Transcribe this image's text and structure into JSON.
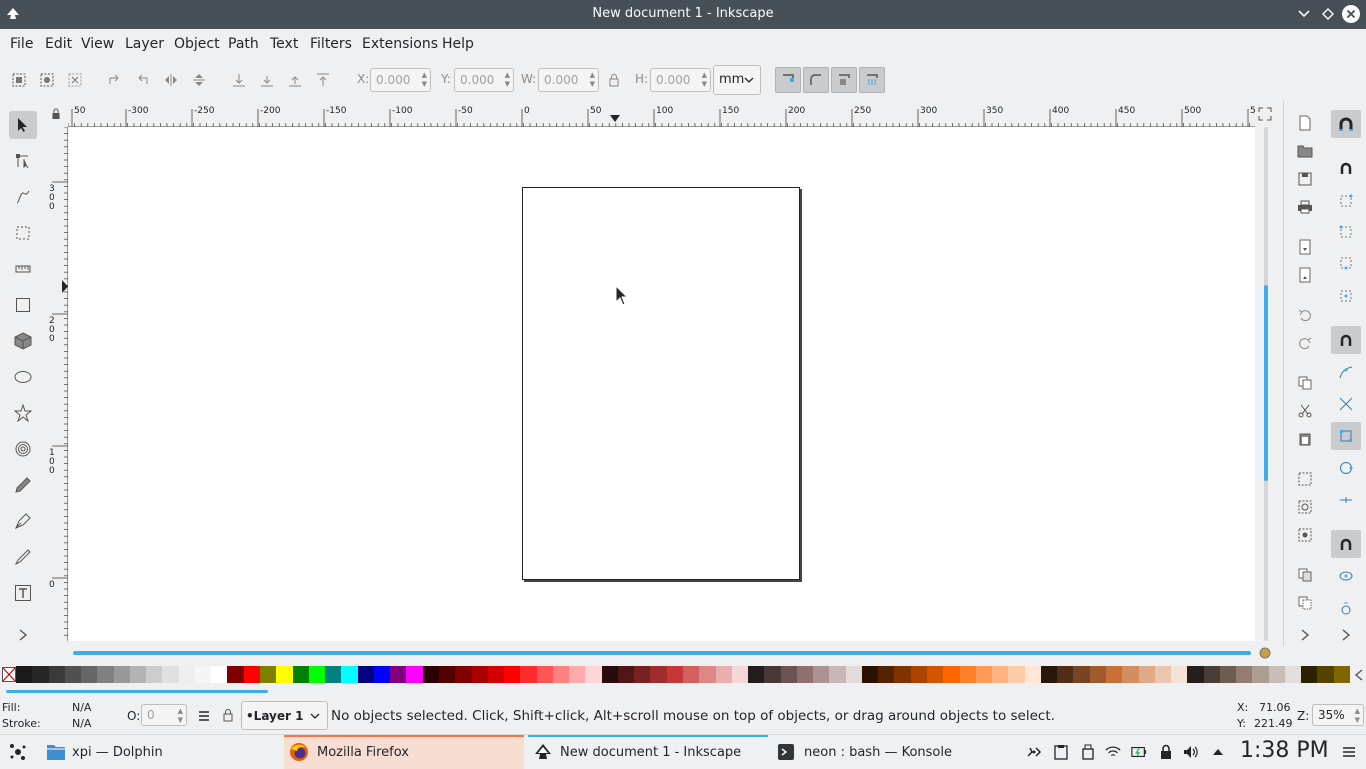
{
  "window": {
    "title": "New document 1 - Inkscape"
  },
  "menu": [
    "File",
    "Edit",
    "View",
    "Layer",
    "Object",
    "Path",
    "Text",
    "Filters",
    "Extensions",
    "Help"
  ],
  "tool_controls": {
    "x_label": "X:",
    "x_value": "0.000",
    "y_label": "Y:",
    "y_value": "0.000",
    "w_label": "W:",
    "w_value": "0.000",
    "h_label": "H:",
    "h_value": "0.000",
    "unit": "mm"
  },
  "hruler_labels": [
    "50",
    "-300",
    "-250",
    "-200",
    "-150",
    "-100",
    "-50",
    "0",
    "50",
    "100",
    "150",
    "200",
    "250",
    "300",
    "350",
    "400",
    "450",
    "500",
    "5"
  ],
  "vruler_labels": [
    [
      "3",
      "0",
      "0"
    ],
    [
      "2",
      "0",
      "0"
    ],
    [
      "1",
      "0",
      "0"
    ],
    [
      "0"
    ]
  ],
  "palette": [
    "#1a1a1a",
    "#262626",
    "#3a3a3a",
    "#505050",
    "#666666",
    "#808080",
    "#999999",
    "#b3b3b3",
    "#cccccc",
    "#e0e0e0",
    "#eeeeee",
    "#f5f5f5",
    "#ffffff",
    "#800000",
    "#ff0000",
    "#808000",
    "#ffff00",
    "#008000",
    "#00ff00",
    "#008080",
    "#00ffff",
    "#000080",
    "#0000ff",
    "#800080",
    "#ff00ff",
    "#2b0000",
    "#550000",
    "#800000",
    "#aa0000",
    "#d40000",
    "#ff0000",
    "#ff2a2a",
    "#ff5555",
    "#ff8080",
    "#ffaaaa",
    "#ffd5d5",
    "#280b0b",
    "#501616",
    "#782121",
    "#a02c2c",
    "#c83737",
    "#d35f5f",
    "#de8787",
    "#e9afaf",
    "#f4d7d7",
    "#241c1c",
    "#483737",
    "#6c5353",
    "#916f6f",
    "#ac9393",
    "#c8b7b7",
    "#e3dbdb",
    "#2b1100",
    "#552200",
    "#803300",
    "#aa4400",
    "#d45500",
    "#ff6600",
    "#ff7f2a",
    "#ff9955",
    "#ffb380",
    "#ffccaa",
    "#ffe6d5",
    "#28170b",
    "#502d16",
    "#784421",
    "#a05a2c",
    "#c87137",
    "#d38d5f",
    "#deaa87",
    "#e9c6af",
    "#f4e3d7",
    "#241f1c",
    "#483e37",
    "#6c5d53",
    "#917c6f",
    "#ac9d93",
    "#c8beb7",
    "#e3dedb",
    "#2b2200",
    "#554400",
    "#806600"
  ],
  "status": {
    "fill_label": "Fill:",
    "fill_value": "N/A",
    "stroke_label": "Stroke:",
    "stroke_value": "N/A",
    "opacity_label": "O:",
    "opacity_value": "0",
    "layer": "•Layer 1",
    "message": "No objects selected. Click, Shift+click, Alt+scroll mouse on top of objects, or drag around objects to select.",
    "x_label": "X:",
    "x_value": "71.06",
    "y_label": "Y:",
    "y_value": "221.49",
    "zoom_label": "Z:",
    "zoom_value": "35%"
  },
  "taskbar": {
    "tasks": [
      {
        "label": "xpi — Dolphin",
        "state": "normal"
      },
      {
        "label": "Mozilla Firefox",
        "state": "attention"
      },
      {
        "label": "New document 1 - Inkscape",
        "state": "active"
      },
      {
        "label": "neon : bash — Konsole",
        "state": "normal"
      }
    ],
    "clock": "1:38 PM"
  },
  "colors": {
    "titlebar": "#475057",
    "accent": "#3daee9",
    "attention": "#f6744a"
  }
}
